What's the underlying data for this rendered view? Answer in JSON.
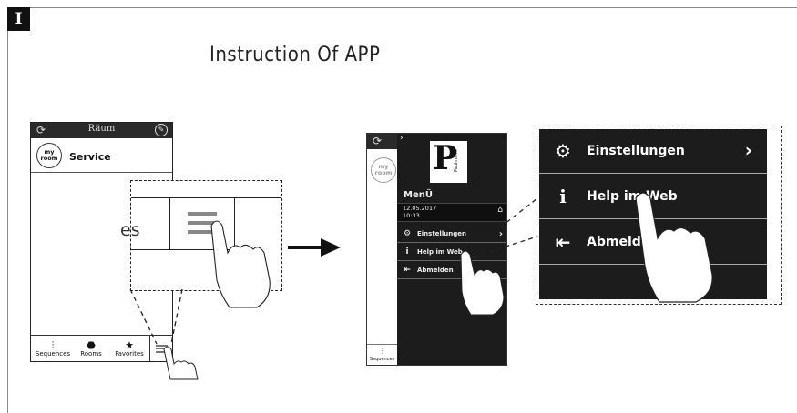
{
  "badge": "I",
  "title": "Instruction Of APP",
  "phone1": {
    "header_title": "Räum",
    "room_icon_top": "my",
    "room_icon_bottom": "room",
    "service_label": "Service",
    "partial_text": "es",
    "tabs": [
      {
        "label": "Sequences",
        "icon": "sequences-icon"
      },
      {
        "label": "Rooms",
        "icon": "rooms-icon"
      },
      {
        "label": "Favorites",
        "icon": "star-icon"
      }
    ]
  },
  "phone2": {
    "logo_letter": "P",
    "logo_word": "Paulmann",
    "room_icon_top": "my",
    "room_icon_bottom": "room",
    "menu_title": "MenÜ",
    "date": "12.05.2017",
    "time": "10:33",
    "items": [
      "Einstellungen",
      "Help im Web",
      "Abmelden"
    ],
    "bottom_tab": "Sequences"
  },
  "zoom": {
    "items": [
      "Einstellungen",
      "Help im Web",
      "Abmelden"
    ]
  },
  "colors": {
    "dark_panel": "#1c1c1c",
    "header": "#2a2a2a",
    "line": "#222222"
  }
}
